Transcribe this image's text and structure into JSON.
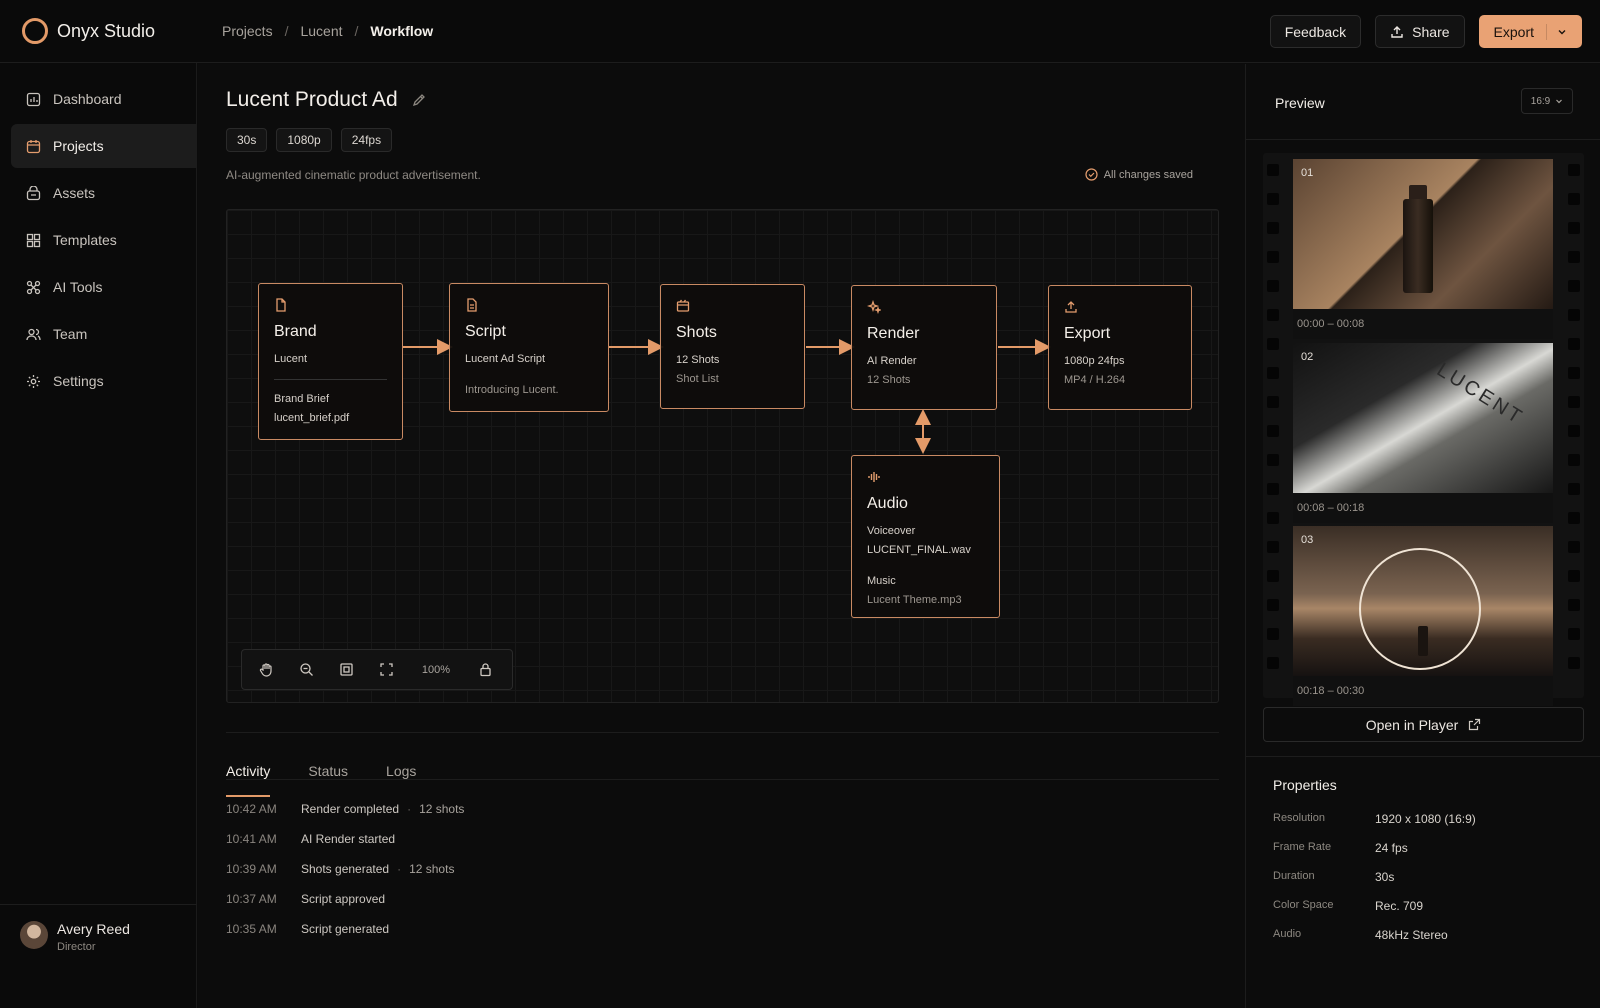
{
  "app": {
    "name": "Onyx Studio"
  },
  "breadcrumb": {
    "items": [
      "Projects",
      "Lucent"
    ],
    "current": "Workflow",
    "separator": "/"
  },
  "top_actions": {
    "feedback": "Feedback",
    "share": "Share",
    "export": "Export"
  },
  "sidebar": {
    "items": [
      {
        "label": "Dashboard",
        "icon": "dashboard-icon"
      },
      {
        "label": "Projects",
        "icon": "projects-icon",
        "active": true
      },
      {
        "label": "Assets",
        "icon": "assets-icon"
      },
      {
        "label": "Templates",
        "icon": "templates-icon"
      },
      {
        "label": "AI Tools",
        "icon": "ai-tools-icon"
      },
      {
        "label": "Team",
        "icon": "team-icon"
      },
      {
        "label": "Settings",
        "icon": "gear-icon"
      }
    ],
    "user": {
      "name": "Avery Reed",
      "role": "Director"
    }
  },
  "project": {
    "title": "Lucent Product Ad",
    "chips": [
      "30s",
      "1080p",
      "24fps"
    ],
    "description": "AI-augmented cinematic product advertisement.",
    "saved_status": "All changes saved"
  },
  "workflow": {
    "nodes": {
      "brand": {
        "title": "Brand",
        "line1": "Lucent",
        "line2": "Brand Brief",
        "line3": "lucent_brief.pdf"
      },
      "script": {
        "title": "Script",
        "line1": "Lucent Ad Script",
        "line2": "Introducing Lucent."
      },
      "shots": {
        "title": "Shots",
        "line1": "12 Shots",
        "line2": "Shot List"
      },
      "render": {
        "title": "Render",
        "line1": "AI Render",
        "line2": "12 Shots"
      },
      "export": {
        "title": "Export",
        "line1": "1080p 24fps",
        "line2": "MP4 / H.264"
      },
      "audio": {
        "title": "Audio",
        "line1": "Voiceover",
        "line2": "LUCENT_FINAL.wav",
        "line3": "Music",
        "line4": "Lucent Theme.mp3"
      }
    },
    "zoom": "100%"
  },
  "tabs": [
    "Activity",
    "Status",
    "Logs"
  ],
  "activity": [
    {
      "time": "10:42 AM",
      "text": "Render completed",
      "extra": "12 shots"
    },
    {
      "time": "10:41 AM",
      "text": "AI Render started",
      "extra": ""
    },
    {
      "time": "10:39 AM",
      "text": "Shots generated",
      "extra": "12 shots"
    },
    {
      "time": "10:37 AM",
      "text": "Script approved",
      "extra": ""
    },
    {
      "time": "10:35 AM",
      "text": "Script generated",
      "extra": ""
    }
  ],
  "preview": {
    "title": "Preview",
    "ratio": "16:9",
    "frames": [
      {
        "num": "01",
        "timecode": "00:00 – 00:08"
      },
      {
        "num": "02",
        "timecode": "00:08 – 00:18",
        "image_text": "LUCENT"
      },
      {
        "num": "03",
        "timecode": "00:18 – 00:30"
      }
    ],
    "open_player": "Open in Player"
  },
  "properties": {
    "title": "Properties",
    "rows": [
      {
        "key": "Resolution",
        "value": "1920 x 1080 (16:9)"
      },
      {
        "key": "Frame Rate",
        "value": "24 fps"
      },
      {
        "key": "Duration",
        "value": "30s"
      },
      {
        "key": "Color Space",
        "value": "Rec. 709"
      },
      {
        "key": "Audio",
        "value": "48kHz Stereo"
      }
    ]
  },
  "colors": {
    "accent": "#e9a274",
    "node_border": "#c98a63",
    "background": "#0b0b0b"
  }
}
